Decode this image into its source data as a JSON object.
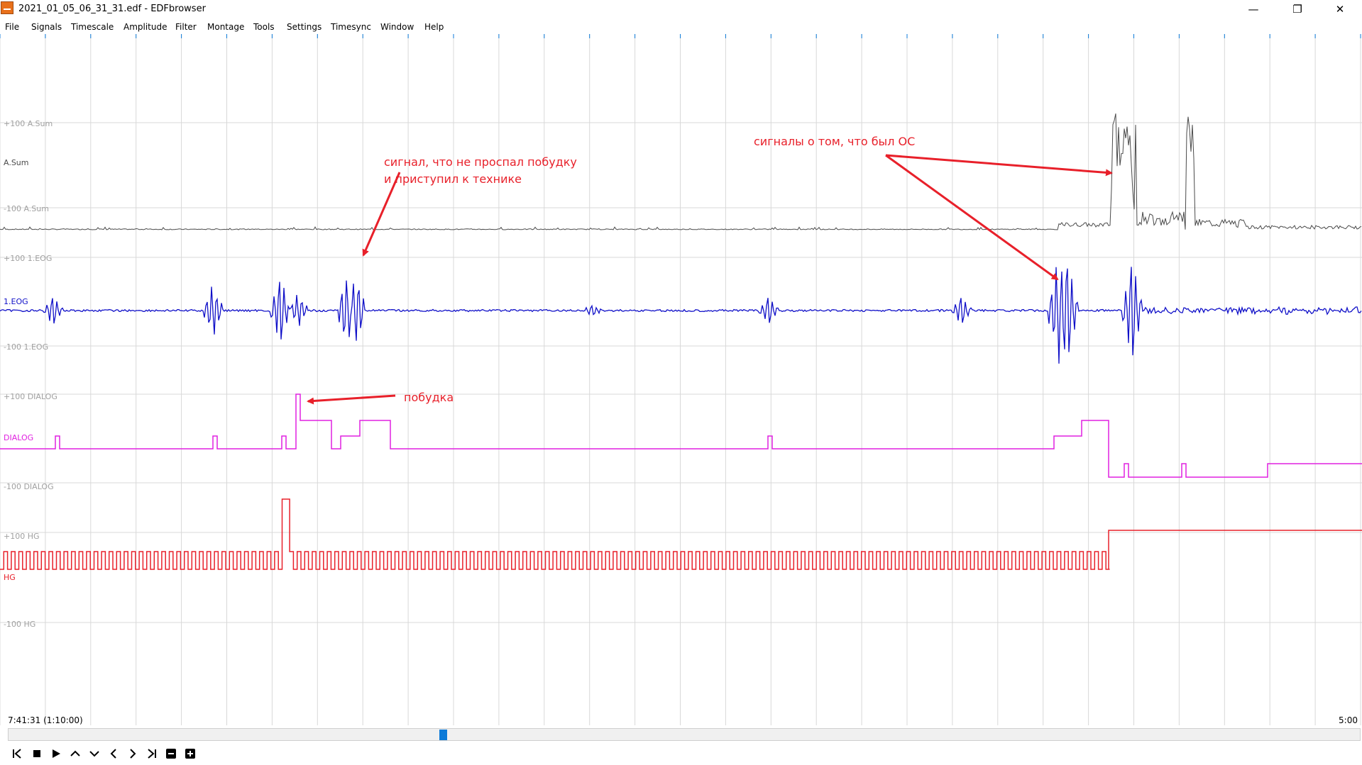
{
  "window": {
    "title": "2021_01_05_06_31_31.edf - EDFbrowser",
    "controls": [
      "minimize",
      "restore",
      "close"
    ]
  },
  "menu": [
    {
      "label": "File"
    },
    {
      "label": "Signals"
    },
    {
      "label": "Timescale"
    },
    {
      "label": "Amplitude"
    },
    {
      "label": "Filter"
    },
    {
      "label": "Montage"
    },
    {
      "label": "Tools"
    },
    {
      "label": "Settings"
    },
    {
      "label": "Timesync"
    },
    {
      "label": "Window"
    },
    {
      "label": "Help"
    }
  ],
  "signals": [
    {
      "name": "A.Sum",
      "upper_label": "+100 A.Sum",
      "lower_label": "-100 A.Sum",
      "color": "#4a4a4a"
    },
    {
      "name": "1.EOG",
      "upper_label": "+100 1.EOG",
      "lower_label": "-100 1.EOG",
      "color": "#1010c8"
    },
    {
      "name": "DIALOG",
      "upper_label": "+100 DIALOG",
      "lower_label": "-100 DIALOG",
      "color": "#e020e0"
    },
    {
      "name": "HG",
      "upper_label": "+100 HG",
      "lower_label": "-100 HG",
      "color": "#e8202a"
    }
  ],
  "annotations": {
    "technique_line1": "сигнал, что не проспал побудку",
    "technique_line2": "и   приступил к технике",
    "wake": "побудка",
    "oc": "сигналы о том, что был ОС",
    "color": "#e8202a"
  },
  "timeline": {
    "position": "7:41:31 (1:10:00)",
    "window": "5:00"
  },
  "toolbar": {
    "buttons": [
      "jump-start",
      "stop",
      "play",
      "page-up",
      "page-down",
      "prev-page",
      "next-page",
      "jump-end",
      "zoom-out",
      "zoom-in"
    ]
  },
  "colors": {
    "grid": "#d8d8d8",
    "label": "#999999",
    "accent": "#0c7ad8"
  }
}
